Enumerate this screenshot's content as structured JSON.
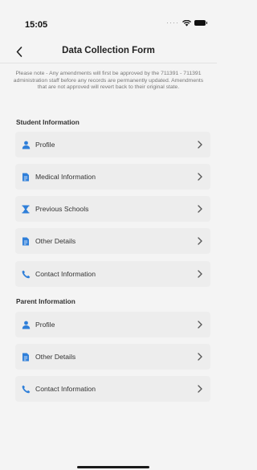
{
  "status_bar": {
    "time": "15:05"
  },
  "header": {
    "title": "Data Collection Form"
  },
  "notice": "Please note - Any amendments will first be approved by the 711391 - 711391 administration staff before any records are permanently updated. Amendments that are not approved will revert back to their original state.",
  "student_section": {
    "title": "Student Information",
    "items": [
      {
        "label": "Profile",
        "icon": "person-icon"
      },
      {
        "label": "Medical Information",
        "icon": "document-icon"
      },
      {
        "label": "Previous Schools",
        "icon": "hourglass-icon"
      },
      {
        "label": "Other Details",
        "icon": "document-icon"
      },
      {
        "label": "Contact Information",
        "icon": "phone-icon"
      }
    ]
  },
  "parent_section": {
    "title": "Parent Information",
    "items": [
      {
        "label": "Profile",
        "icon": "person-icon"
      },
      {
        "label": "Other Details",
        "icon": "document-icon"
      },
      {
        "label": "Contact Information",
        "icon": "phone-icon"
      }
    ]
  },
  "colors": {
    "accent": "#2f7fd9",
    "item_bg": "#ededed",
    "background": "#f4f4f4"
  }
}
